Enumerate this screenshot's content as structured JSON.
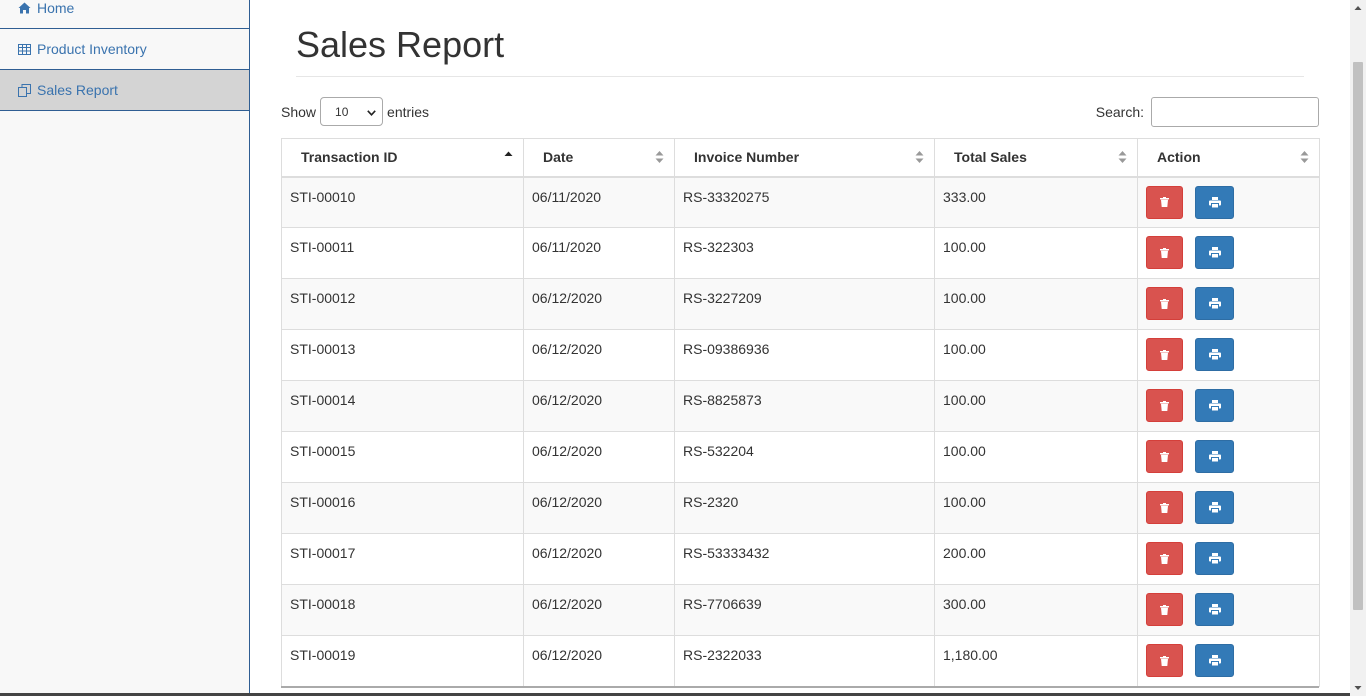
{
  "sidebar": {
    "items": [
      {
        "label": "Home",
        "icon": "home-icon"
      },
      {
        "label": "Product Inventory",
        "icon": "table-icon"
      },
      {
        "label": "Sales Report",
        "icon": "copy-icon",
        "active": true
      }
    ]
  },
  "page": {
    "title": "Sales Report"
  },
  "length": {
    "show_label": "Show",
    "value": "10",
    "entries_label": "entries"
  },
  "search": {
    "label": "Search:",
    "value": "",
    "placeholder": ""
  },
  "table": {
    "columns": [
      "Transaction ID",
      "Date",
      "Invoice Number",
      "Total Sales",
      "Action"
    ],
    "sorted_column": "Transaction ID",
    "sort_direction": "ascending",
    "rows": [
      {
        "id": "STI-00010",
        "date": "06/11/2020",
        "invoice": "RS-33320275",
        "total": "333.00"
      },
      {
        "id": "STI-00011",
        "date": "06/11/2020",
        "invoice": "RS-322303",
        "total": "100.00"
      },
      {
        "id": "STI-00012",
        "date": "06/12/2020",
        "invoice": "RS-3227209",
        "total": "100.00"
      },
      {
        "id": "STI-00013",
        "date": "06/12/2020",
        "invoice": "RS-09386936",
        "total": "100.00"
      },
      {
        "id": "STI-00014",
        "date": "06/12/2020",
        "invoice": "RS-8825873",
        "total": "100.00"
      },
      {
        "id": "STI-00015",
        "date": "06/12/2020",
        "invoice": "RS-532204",
        "total": "100.00"
      },
      {
        "id": "STI-00016",
        "date": "06/12/2020",
        "invoice": "RS-2320",
        "total": "100.00"
      },
      {
        "id": "STI-00017",
        "date": "06/12/2020",
        "invoice": "RS-53333432",
        "total": "200.00"
      },
      {
        "id": "STI-00018",
        "date": "06/12/2020",
        "invoice": "RS-7706639",
        "total": "300.00"
      },
      {
        "id": "STI-00019",
        "date": "06/12/2020",
        "invoice": "RS-2322033",
        "total": "1,180.00"
      }
    ],
    "row_actions": [
      {
        "name": "delete",
        "icon": "trash-icon",
        "color": "#d9534f"
      },
      {
        "name": "print",
        "icon": "print-icon",
        "color": "#337ab7"
      }
    ]
  },
  "colors": {
    "link": "#3a73ae",
    "nav_border": "#2f5e93",
    "active_nav": "#d4d4d4"
  }
}
